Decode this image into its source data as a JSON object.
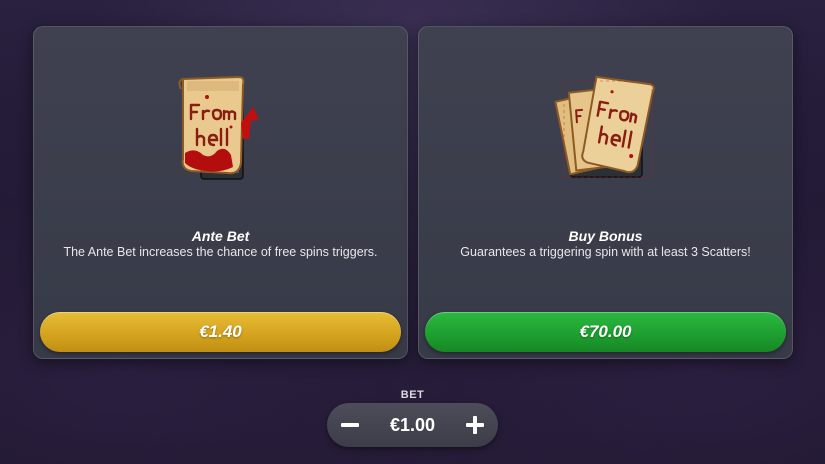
{
  "cards": {
    "ante": {
      "icon": "from-hell-scroll-icon",
      "title": "Ante Bet",
      "description": "The Ante Bet increases the chance of free spins triggers.",
      "price": "€1.40",
      "button_color": "#d9a822"
    },
    "buy": {
      "icon": "from-hell-scroll-stack-icon",
      "title": "Buy Bonus",
      "description": "Guarantees a triggering spin with at least 3 Scatters!",
      "price": "€70.00",
      "button_color": "#22a535"
    }
  },
  "bet": {
    "label": "BET",
    "value": "€1.00",
    "decrease_icon": "minus-icon",
    "increase_icon": "plus-icon"
  }
}
